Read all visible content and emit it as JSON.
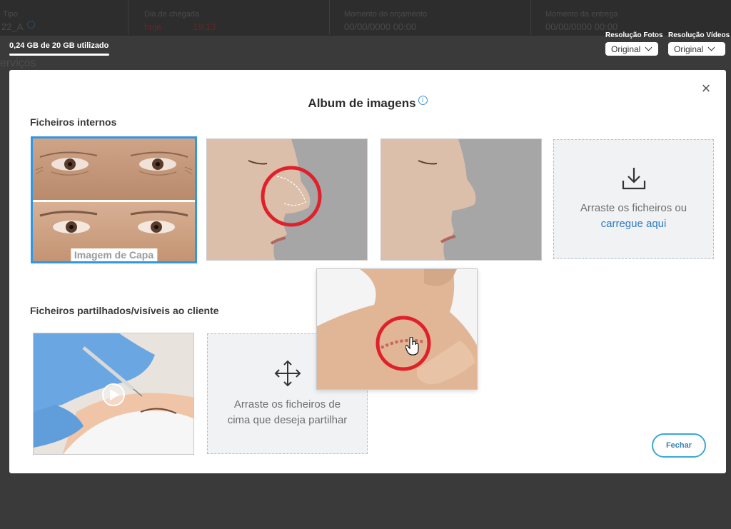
{
  "background": {
    "columns": [
      {
        "label": "Tipo",
        "value": "22_A"
      },
      {
        "label": "Dia de chegada",
        "value": "hoje",
        "time": "19:13"
      },
      {
        "label": "Momento do orçamento",
        "value": "00/00/0000 00:00"
      },
      {
        "label": "Momento da entrega",
        "value": "00/00/0000 00:00"
      }
    ],
    "left_text": "erviços"
  },
  "storage": {
    "text": "0,24 GB de 20 GB utilizado",
    "used_fraction": 0.012
  },
  "resolution_photos": {
    "label": "Resolução Fotos",
    "value": "Original"
  },
  "resolution_videos": {
    "label": "Resolução Vídeos",
    "value": "Original"
  },
  "modal": {
    "title": "Album de imagens",
    "info_icon": "info-icon",
    "close_label": "×",
    "internal_section": "Ficheiros internos",
    "cover_label": "Imagem de Capa",
    "upload_text": "Arraste os ficheiros ou",
    "upload_link": "carregue aqui",
    "shared_section": "Ficheiros partilhados/visíveis ao cliente",
    "share_drop_text_1": "Arraste os ficheiros de",
    "share_drop_text_2": "cima que deseja partilhar",
    "close_button": "Fechar"
  },
  "colors": {
    "accent": "#2f97e6",
    "annotation_red": "#e0202a"
  }
}
